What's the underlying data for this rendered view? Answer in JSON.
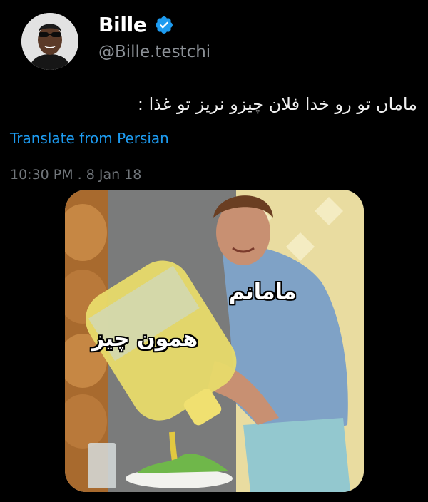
{
  "author": {
    "display_name": "Bille",
    "handle": "@Bille.testchi",
    "verified": true,
    "verified_icon": "verified-badge-icon"
  },
  "tweet": {
    "text": "ماماں تو رو خدا فلان چیزو نریز تو غذا :",
    "translate_label": "Translate from Persian",
    "timestamp": "10:30 PM . 8 Jan 18"
  },
  "media": {
    "description_labels": {
      "mom": "مامانم",
      "stuff": "همون چیز"
    }
  },
  "colors": {
    "background": "#000000",
    "link": "#1d9bf0",
    "muted": "#71767b",
    "verified": "#1d9bf0"
  }
}
